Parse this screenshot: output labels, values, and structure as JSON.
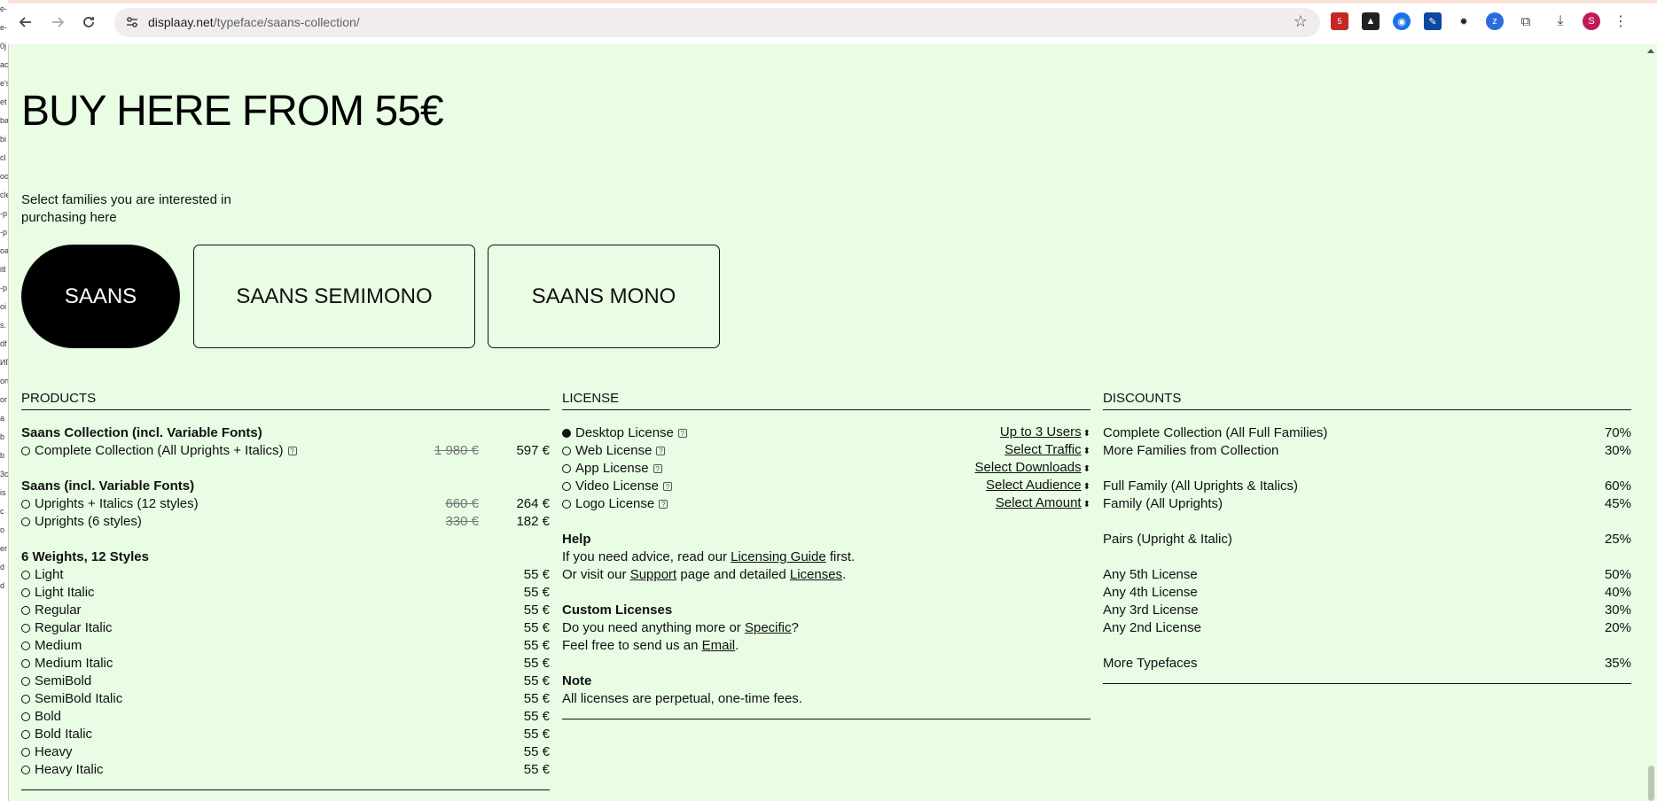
{
  "browser": {
    "url_host": "displaay.net",
    "url_path": "/typeface/saans-collection/",
    "ext_badge": "5",
    "profile_initial": "S"
  },
  "left_strip": [
    "e-",
    "e-",
    "0j",
    "ace",
    "e's",
    "et",
    "ba",
    "bi",
    "cl",
    "oo",
    "cle",
    "-p",
    "-p",
    "oa",
    "itl",
    "-p",
    "oi",
    "s.",
    "df",
    "ИГ",
    "ort",
    "or",
    "a",
    "b",
    "b",
    "3c",
    "is",
    "c",
    "o",
    "er",
    "d",
    "d"
  ],
  "hero_title": "BUY HERE FROM 55€",
  "intro": "Select families you are interested in purchasing here",
  "families": [
    {
      "label": "SAANS",
      "active": true
    },
    {
      "label": "SAANS SEMIMONO",
      "active": false
    },
    {
      "label": "SAANS MONO",
      "active": false
    }
  ],
  "products": {
    "heading": "PRODUCTS",
    "groups": [
      {
        "title": "Saans Collection (incl. Variable Fonts)",
        "items": [
          {
            "label": "Complete Collection (All Uprights + Italics)",
            "info": true,
            "old_price": "1 980 €",
            "price": "597 €"
          }
        ]
      },
      {
        "title": "Saans (incl. Variable Fonts)",
        "items": [
          {
            "label": "Uprights + Italics (12 styles)",
            "info": false,
            "old_price": "660 €",
            "price": "264 €"
          },
          {
            "label": "Uprights (6 styles)",
            "info": false,
            "old_price": "330 €",
            "price": "182 €"
          }
        ]
      },
      {
        "title": "6 Weights, 12 Styles",
        "items": [
          {
            "label": "Light",
            "info": false,
            "old_price": "",
            "price": "55 €"
          },
          {
            "label": "Light Italic",
            "info": false,
            "old_price": "",
            "price": "55 €"
          },
          {
            "label": "Regular",
            "info": false,
            "old_price": "",
            "price": "55 €"
          },
          {
            "label": "Regular Italic",
            "info": false,
            "old_price": "",
            "price": "55 €"
          },
          {
            "label": "Medium",
            "info": false,
            "old_price": "",
            "price": "55 €"
          },
          {
            "label": "Medium Italic",
            "info": false,
            "old_price": "",
            "price": "55 €"
          },
          {
            "label": "SemiBold",
            "info": false,
            "old_price": "",
            "price": "55 €"
          },
          {
            "label": "SemiBold Italic",
            "info": false,
            "old_price": "",
            "price": "55 €"
          },
          {
            "label": "Bold",
            "info": false,
            "old_price": "",
            "price": "55 €"
          },
          {
            "label": "Bold Italic",
            "info": false,
            "old_price": "",
            "price": "55 €"
          },
          {
            "label": "Heavy",
            "info": false,
            "old_price": "",
            "price": "55 €"
          },
          {
            "label": "Heavy Italic",
            "info": false,
            "old_price": "",
            "price": "55 €"
          }
        ]
      }
    ]
  },
  "license": {
    "heading": "LICENSE",
    "items": [
      {
        "label": "Desktop License",
        "selected": true,
        "select": "Up to 3 Users"
      },
      {
        "label": "Web License",
        "selected": false,
        "select": "Select Traffic"
      },
      {
        "label": "App License",
        "selected": false,
        "select": "Select Downloads"
      },
      {
        "label": "Video License",
        "selected": false,
        "select": "Select Audience"
      },
      {
        "label": "Logo License",
        "selected": false,
        "select": "Select Amount"
      }
    ],
    "help": {
      "title": "Help",
      "l1_a": "If you need advice, read our ",
      "l1_link": "Licensing Guide",
      "l1_b": " first.",
      "l2_a": "Or visit our ",
      "l2_link1": "Support",
      "l2_b": " page and detailed ",
      "l2_link2": "Licenses",
      "l2_c": "."
    },
    "custom": {
      "title": "Custom Licenses",
      "l1_a": "Do you need anything more or ",
      "l1_link": "Specific",
      "l1_b": "?",
      "l2_a": "Feel free to send us an ",
      "l2_link": "Email",
      "l2_b": "."
    },
    "note": {
      "title": "Note",
      "text": "All licenses are perpetual, one-time fees."
    }
  },
  "discounts": {
    "heading": "DISCOUNTS",
    "groups": [
      [
        {
          "label": "Complete Collection (All Full Families)",
          "value": "70%"
        },
        {
          "label": "More Families from Collection",
          "value": "30%"
        }
      ],
      [
        {
          "label": "Full Family (All Uprights & Italics)",
          "value": "60%"
        },
        {
          "label": "Family (All Uprights)",
          "value": "45%"
        }
      ],
      [
        {
          "label": "Pairs (Upright & Italic)",
          "value": "25%"
        }
      ],
      [
        {
          "label": "Any 5th License",
          "value": "50%"
        },
        {
          "label": "Any 4th License",
          "value": "40%"
        },
        {
          "label": "Any 3rd License",
          "value": "30%"
        },
        {
          "label": "Any 2nd License",
          "value": "20%"
        }
      ],
      [
        {
          "label": "More Typefaces",
          "value": "35%"
        }
      ]
    ]
  }
}
